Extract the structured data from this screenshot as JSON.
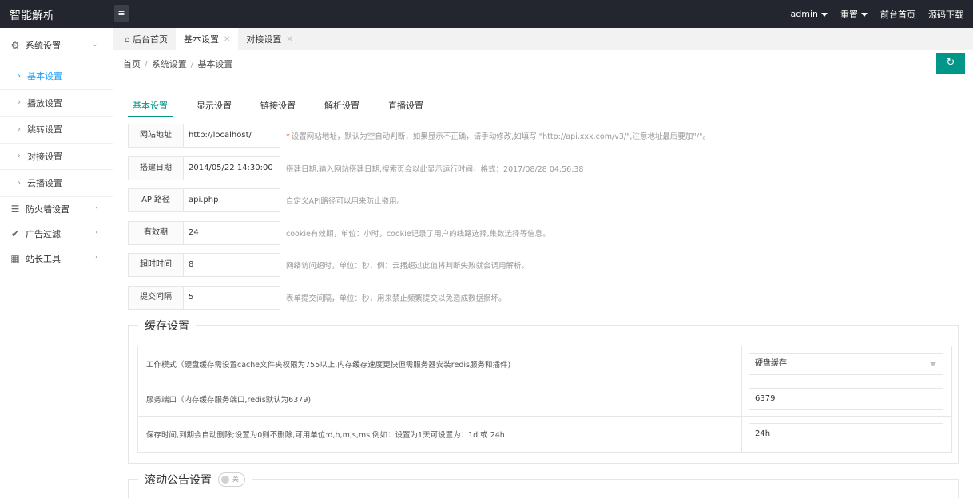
{
  "app": {
    "title": "智能解析"
  },
  "header": {
    "menu_icon": "menu-icon",
    "user": "admin",
    "reset": "重置",
    "front": "前台首页",
    "download": "源码下载"
  },
  "sidebar": {
    "group_system": "系统设置",
    "items": [
      "基本设置",
      "播放设置",
      "跳转设置",
      "对接设置",
      "云播设置"
    ],
    "group_firewall": "防火墙设置",
    "group_ad": "广告过滤",
    "group_tools": "站长工具"
  },
  "tabs": [
    "后台首页",
    "基本设置",
    "对接设置"
  ],
  "breadcrumb": [
    "首页",
    "系统设置",
    "基本设置"
  ],
  "subtabs": [
    "基本设置",
    "显示设置",
    "链接设置",
    "解析设置",
    "直播设置"
  ],
  "form": [
    {
      "label": "网站地址",
      "value": "http://localhost/",
      "hint": "设置网站地址，默认为空自动判断，如果显示不正确，请手动修改,如填写 \"http://api.xxx.com/v3/\",注意地址最后要加\"/\"。",
      "required": "*"
    },
    {
      "label": "搭建日期",
      "value": "2014/05/22 14:30:00",
      "hint": "搭建日期,输入网站搭建日期,搜索页会以此显示运行时间，格式：2017/08/28 04:56:38"
    },
    {
      "label": "API路径",
      "value": "api.php",
      "hint": "自定义API路径可以用来防止盗用。"
    },
    {
      "label": "有效期",
      "value": "24",
      "hint": "cookie有效期，单位：小时，cookie记录了用户的线路选择,集数选择等信息。"
    },
    {
      "label": "超时时间",
      "value": "8",
      "hint": "网络访问超时，单位：秒，例：云播超过此值将判断失败就会调用解析。"
    },
    {
      "label": "提交间隔",
      "value": "5",
      "hint": "表单提交间隔，单位：秒，用来禁止频繁提交以免造成数据损坏。"
    }
  ],
  "cache": {
    "title": "缓存设置",
    "rows": [
      {
        "label": "工作模式（硬盘缓存需设置cache文件夹权限为755以上,内存缓存速度更快但需服务器安装redis服务和插件)",
        "value": "硬盘缓存"
      },
      {
        "label": "服务端口（内存缓存服务端口,redis默认为6379)",
        "value": "6379"
      },
      {
        "label": "保存时间,到期会自动删除;设置为0则不删除,可用单位:d,h,m,s,ms,例如：设置为1天可设置为：1d 或 24h",
        "value": "24h"
      }
    ]
  },
  "notice": {
    "title": "滚动公告设置",
    "switch_text": "关"
  }
}
